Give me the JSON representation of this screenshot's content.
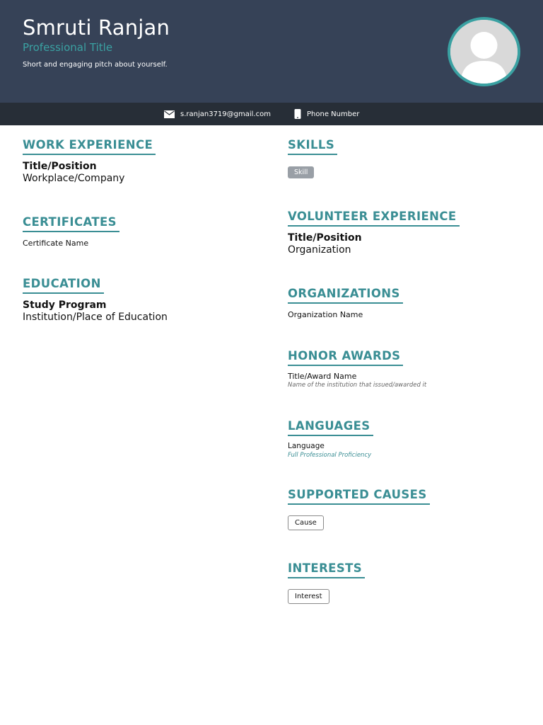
{
  "header": {
    "name": "Smruti Ranjan",
    "professional_title": "Professional Title",
    "pitch": "Short and engaging pitch about yourself."
  },
  "contact": {
    "email": "s.ranjan3719@gmail.com",
    "phone": "Phone Number"
  },
  "work_experience": {
    "heading": "WORK EXPERIENCE",
    "title": "Title/Position",
    "company": "Workplace/Company"
  },
  "certificates": {
    "heading": "CERTIFICATES",
    "name": "Certificate Name"
  },
  "education": {
    "heading": "EDUCATION",
    "program": "Study Program",
    "institution": "Institution/Place of Education"
  },
  "skills": {
    "heading": "SKILLS",
    "items": [
      "Skill"
    ]
  },
  "volunteer": {
    "heading": "VOLUNTEER EXPERIENCE",
    "title": "Title/Position",
    "organization": "Organization"
  },
  "organizations": {
    "heading": "ORGANIZATIONS",
    "name": "Organization Name"
  },
  "honors": {
    "heading": "HONOR AWARDS",
    "title": "Title/Award Name",
    "issuer": "Name of the institution that issued/awarded it"
  },
  "languages": {
    "heading": "LANGUAGES",
    "language": "Language",
    "proficiency": "Full Professional Proficiency"
  },
  "causes": {
    "heading": "SUPPORTED CAUSES",
    "items": [
      "Cause"
    ]
  },
  "interests": {
    "heading": "INTERESTS",
    "items": [
      "Interest"
    ]
  },
  "colors": {
    "header_bg": "#364257",
    "contact_bar_bg": "#272e37",
    "accent_teal": "#3a8e94",
    "skill_chip_bg": "#999fa6"
  }
}
